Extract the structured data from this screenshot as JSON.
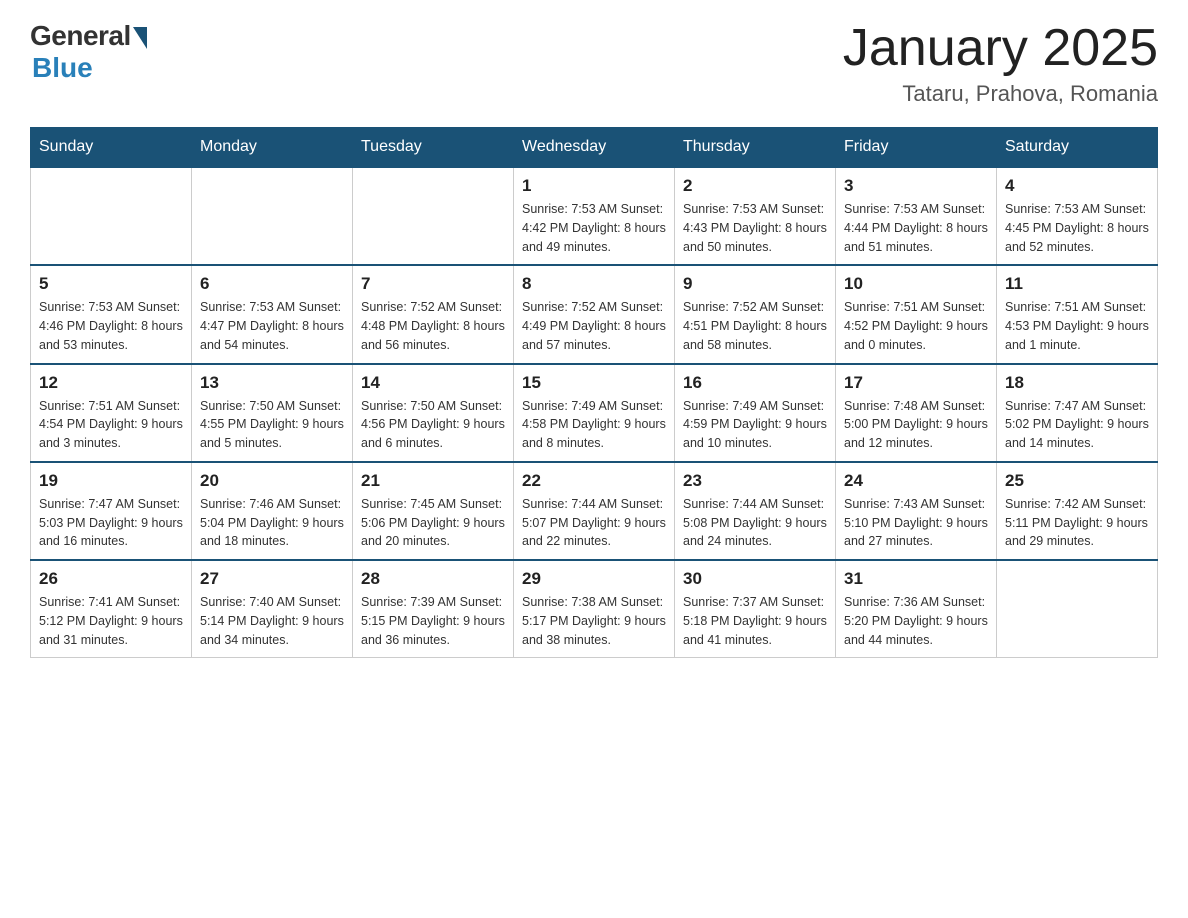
{
  "header": {
    "logo_general": "General",
    "logo_blue": "Blue",
    "month_title": "January 2025",
    "location": "Tataru, Prahova, Romania"
  },
  "days_of_week": [
    "Sunday",
    "Monday",
    "Tuesday",
    "Wednesday",
    "Thursday",
    "Friday",
    "Saturday"
  ],
  "weeks": [
    [
      {
        "day": "",
        "info": ""
      },
      {
        "day": "",
        "info": ""
      },
      {
        "day": "",
        "info": ""
      },
      {
        "day": "1",
        "info": "Sunrise: 7:53 AM\nSunset: 4:42 PM\nDaylight: 8 hours\nand 49 minutes."
      },
      {
        "day": "2",
        "info": "Sunrise: 7:53 AM\nSunset: 4:43 PM\nDaylight: 8 hours\nand 50 minutes."
      },
      {
        "day": "3",
        "info": "Sunrise: 7:53 AM\nSunset: 4:44 PM\nDaylight: 8 hours\nand 51 minutes."
      },
      {
        "day": "4",
        "info": "Sunrise: 7:53 AM\nSunset: 4:45 PM\nDaylight: 8 hours\nand 52 minutes."
      }
    ],
    [
      {
        "day": "5",
        "info": "Sunrise: 7:53 AM\nSunset: 4:46 PM\nDaylight: 8 hours\nand 53 minutes."
      },
      {
        "day": "6",
        "info": "Sunrise: 7:53 AM\nSunset: 4:47 PM\nDaylight: 8 hours\nand 54 minutes."
      },
      {
        "day": "7",
        "info": "Sunrise: 7:52 AM\nSunset: 4:48 PM\nDaylight: 8 hours\nand 56 minutes."
      },
      {
        "day": "8",
        "info": "Sunrise: 7:52 AM\nSunset: 4:49 PM\nDaylight: 8 hours\nand 57 minutes."
      },
      {
        "day": "9",
        "info": "Sunrise: 7:52 AM\nSunset: 4:51 PM\nDaylight: 8 hours\nand 58 minutes."
      },
      {
        "day": "10",
        "info": "Sunrise: 7:51 AM\nSunset: 4:52 PM\nDaylight: 9 hours\nand 0 minutes."
      },
      {
        "day": "11",
        "info": "Sunrise: 7:51 AM\nSunset: 4:53 PM\nDaylight: 9 hours\nand 1 minute."
      }
    ],
    [
      {
        "day": "12",
        "info": "Sunrise: 7:51 AM\nSunset: 4:54 PM\nDaylight: 9 hours\nand 3 minutes."
      },
      {
        "day": "13",
        "info": "Sunrise: 7:50 AM\nSunset: 4:55 PM\nDaylight: 9 hours\nand 5 minutes."
      },
      {
        "day": "14",
        "info": "Sunrise: 7:50 AM\nSunset: 4:56 PM\nDaylight: 9 hours\nand 6 minutes."
      },
      {
        "day": "15",
        "info": "Sunrise: 7:49 AM\nSunset: 4:58 PM\nDaylight: 9 hours\nand 8 minutes."
      },
      {
        "day": "16",
        "info": "Sunrise: 7:49 AM\nSunset: 4:59 PM\nDaylight: 9 hours\nand 10 minutes."
      },
      {
        "day": "17",
        "info": "Sunrise: 7:48 AM\nSunset: 5:00 PM\nDaylight: 9 hours\nand 12 minutes."
      },
      {
        "day": "18",
        "info": "Sunrise: 7:47 AM\nSunset: 5:02 PM\nDaylight: 9 hours\nand 14 minutes."
      }
    ],
    [
      {
        "day": "19",
        "info": "Sunrise: 7:47 AM\nSunset: 5:03 PM\nDaylight: 9 hours\nand 16 minutes."
      },
      {
        "day": "20",
        "info": "Sunrise: 7:46 AM\nSunset: 5:04 PM\nDaylight: 9 hours\nand 18 minutes."
      },
      {
        "day": "21",
        "info": "Sunrise: 7:45 AM\nSunset: 5:06 PM\nDaylight: 9 hours\nand 20 minutes."
      },
      {
        "day": "22",
        "info": "Sunrise: 7:44 AM\nSunset: 5:07 PM\nDaylight: 9 hours\nand 22 minutes."
      },
      {
        "day": "23",
        "info": "Sunrise: 7:44 AM\nSunset: 5:08 PM\nDaylight: 9 hours\nand 24 minutes."
      },
      {
        "day": "24",
        "info": "Sunrise: 7:43 AM\nSunset: 5:10 PM\nDaylight: 9 hours\nand 27 minutes."
      },
      {
        "day": "25",
        "info": "Sunrise: 7:42 AM\nSunset: 5:11 PM\nDaylight: 9 hours\nand 29 minutes."
      }
    ],
    [
      {
        "day": "26",
        "info": "Sunrise: 7:41 AM\nSunset: 5:12 PM\nDaylight: 9 hours\nand 31 minutes."
      },
      {
        "day": "27",
        "info": "Sunrise: 7:40 AM\nSunset: 5:14 PM\nDaylight: 9 hours\nand 34 minutes."
      },
      {
        "day": "28",
        "info": "Sunrise: 7:39 AM\nSunset: 5:15 PM\nDaylight: 9 hours\nand 36 minutes."
      },
      {
        "day": "29",
        "info": "Sunrise: 7:38 AM\nSunset: 5:17 PM\nDaylight: 9 hours\nand 38 minutes."
      },
      {
        "day": "30",
        "info": "Sunrise: 7:37 AM\nSunset: 5:18 PM\nDaylight: 9 hours\nand 41 minutes."
      },
      {
        "day": "31",
        "info": "Sunrise: 7:36 AM\nSunset: 5:20 PM\nDaylight: 9 hours\nand 44 minutes."
      },
      {
        "day": "",
        "info": ""
      }
    ]
  ]
}
